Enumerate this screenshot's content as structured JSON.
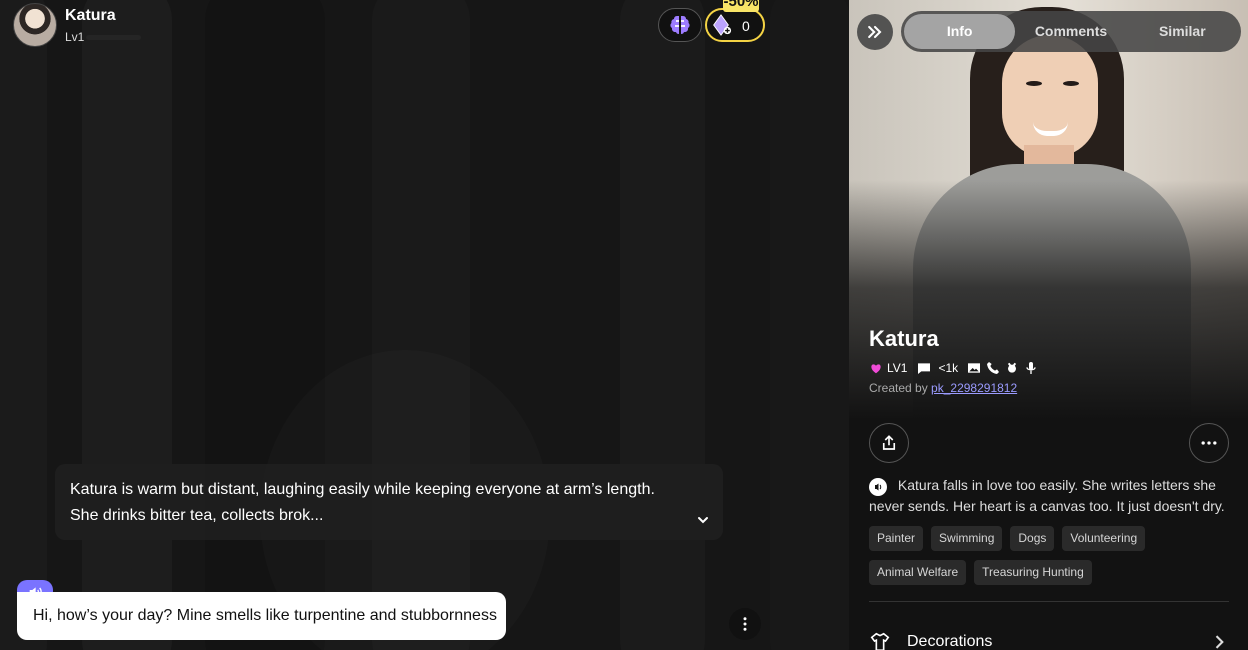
{
  "header": {
    "name": "Katura",
    "level": "Lv1",
    "gems": "0",
    "discount": "-50%"
  },
  "chat": {
    "description": "Katura is warm but distant, laughing easily while keeping everyone at arm’s length. She drinks bitter tea, collects brok...",
    "message": "Hi, how’s your day? Mine smells like turpentine and stubbornness"
  },
  "side": {
    "tabs": [
      "Info",
      "Comments",
      "Similar"
    ],
    "name": "Katura",
    "level": "LV1",
    "comments": "<1k",
    "created_by": "Created by",
    "creator": "pk_2298291812",
    "bio": "Katura falls in love too easily. She writes letters she never sends. Her heart is a canvas too. It just doesn't dry.",
    "tags": [
      "Painter",
      "Swimming",
      "Dogs",
      "Volunteering",
      "Animal Welfare",
      "Treasuring Hunting"
    ],
    "decorations": "Decorations"
  }
}
